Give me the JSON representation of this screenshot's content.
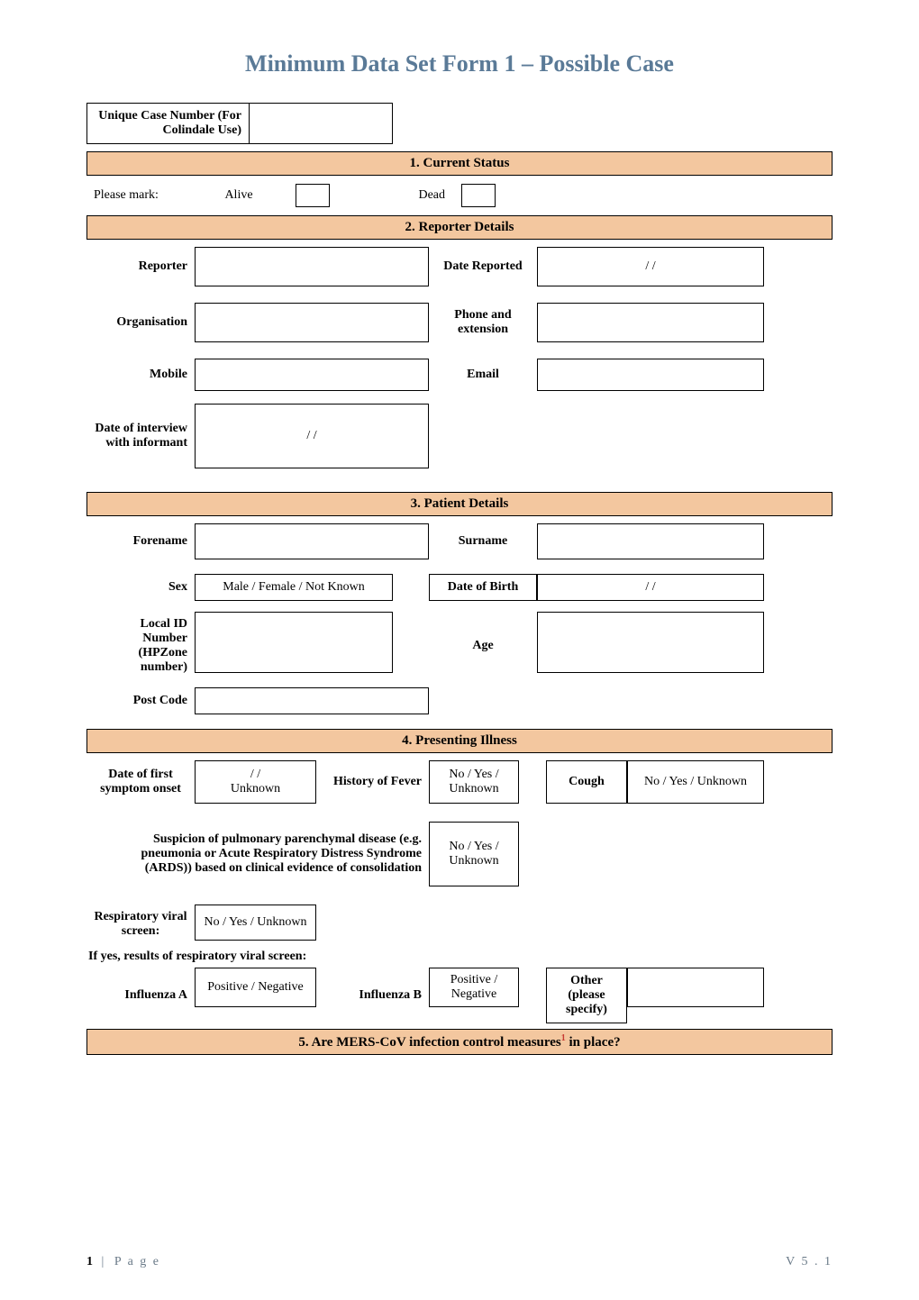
{
  "title": "Minimum Data Set Form 1 – Possible Case",
  "case_number": {
    "label": "Unique Case Number (For Colindale Use)",
    "value": ""
  },
  "sections": {
    "s1": "1. Current Status",
    "s2": "2. Reporter Details",
    "s3": "3. Patient Details",
    "s4": "4. Presenting Illness",
    "s5_prefix": "5. Are MERS-CoV infection control measures",
    "s5_sup": "1",
    "s5_suffix": " in place?"
  },
  "status": {
    "please_mark": "Please mark:",
    "alive": "Alive",
    "dead": "Dead"
  },
  "reporter": {
    "reporter": {
      "label": "Reporter",
      "value": ""
    },
    "date_reported": {
      "label": "Date Reported",
      "value": "/    /"
    },
    "organisation": {
      "label": "Organisation",
      "value": ""
    },
    "phone_ext": {
      "label": "Phone and extension",
      "value": ""
    },
    "mobile": {
      "label": "Mobile",
      "value": ""
    },
    "email": {
      "label": "Email",
      "value": ""
    },
    "date_interview": {
      "label": "Date of interview with informant",
      "value": "/      /"
    }
  },
  "patient": {
    "forename": {
      "label": "Forename",
      "value": ""
    },
    "surname": {
      "label": "Surname",
      "value": ""
    },
    "sex": {
      "label": "Sex",
      "value": "Male / Female / Not Known"
    },
    "dob": {
      "label": "Date of Birth",
      "value": "/    /"
    },
    "local_id": {
      "label": "Local ID Number (HPZone number)",
      "value": ""
    },
    "age": {
      "label": "Age",
      "value": ""
    },
    "postcode": {
      "label": "Post Code",
      "value": ""
    }
  },
  "illness": {
    "onset": {
      "label": "Date of first symptom onset",
      "value": "/    /\nUnknown"
    },
    "fever": {
      "label": "History of Fever",
      "value": "No / Yes / Unknown"
    },
    "cough": {
      "label": "Cough",
      "value": "No / Yes / Unknown"
    },
    "suspicion": {
      "label": "Suspicion of pulmonary parenchymal disease (e.g. pneumonia or Acute Respiratory Distress Syndrome (ARDS)) based on clinical evidence of consolidation",
      "value": "No / Yes / Unknown"
    },
    "resp_screen": {
      "label": "Respiratory viral screen:",
      "value": "No / Yes / Unknown"
    },
    "if_yes": "If yes, results of respiratory viral screen:",
    "flu_a": {
      "label": "Influenza A",
      "value": "Positive / Negative"
    },
    "flu_b": {
      "label": "Influenza B",
      "value": "Positive / Negative"
    },
    "other": {
      "label": "Other (please specify)",
      "value": ""
    }
  },
  "footer": {
    "page_num": "1",
    "page_word": "P a g e",
    "version": "V 5 . 1"
  }
}
